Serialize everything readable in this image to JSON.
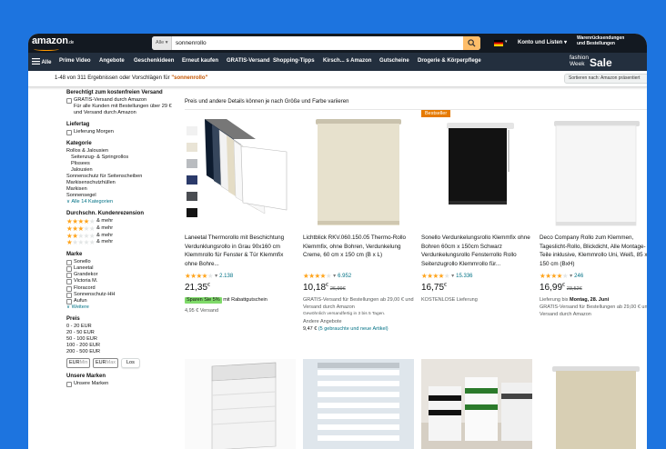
{
  "header": {
    "logo": "amazon",
    "logo_tld": ".de",
    "search_category": "Alle",
    "search_value": "sonnenrollo",
    "account": "Konto und Listen",
    "orders_line1": "Warenrücksendungen",
    "orders_line2": "und Bestellungen"
  },
  "nav": {
    "all": "Alle",
    "items": [
      "Prime Video",
      "Angebote",
      "Geschenkideen",
      "Erneut kaufen",
      "GRATIS-Versand",
      "Shopping-Tipps",
      "Kirsch... s Amazon",
      "Gutscheine",
      "Drogerie & Körperpflege"
    ],
    "fashion": "fashion",
    "fashion2": "Week",
    "sale": "Sale"
  },
  "results": {
    "count": "1-48 von 311 Ergebnissen oder Vorschlägen für ",
    "query": "\"sonnenrollo\"",
    "sort_label": "Sortieren nach:",
    "sort_value": "Amazon präsentiert"
  },
  "sidebar": {
    "free_shipping_heading": "Berechtigt zum kostenfreien Versand",
    "free_shipping_option": "GRATIS-Versand durch Amazon",
    "free_shipping_desc": "Für alle Kunden mit Bestellungen über 29 € und Versand durch Amazon",
    "delivery_heading": "Liefertag",
    "delivery_option": "Lieferung Morgen",
    "category_heading": "Kategorie",
    "categories": [
      "Rollos & Jalousien",
      "Seitenzug- & Springrollos",
      "Plissees",
      "Jalousien",
      "Sonnenschutz für Seitenscheiben",
      "Markisenschutzhüllen",
      "Markisen",
      "Sonnensegel"
    ],
    "categories_more": "∨ Alle 14 Kategorien",
    "review_heading": "Durchschn. Kundenrezension",
    "and_more": "& mehr",
    "brand_heading": "Marke",
    "brands": [
      "Sonello",
      "Laneetal",
      "Grandekor",
      "Victoria M.",
      "Floracord",
      "Sonnenschutz-HH",
      "Aufun"
    ],
    "brands_more": "∨ Weitere",
    "price_heading": "Preis",
    "prices": [
      "0 - 20 EUR",
      "20 - 50 EUR",
      "50 - 100 EUR",
      "100 - 200 EUR",
      "200 - 500 EUR"
    ],
    "min_prefix": "EUR",
    "min_placeholder": "Min",
    "max_prefix": "EUR",
    "max_placeholder": "Max",
    "go": "Los",
    "brands2_heading": "Unsere Marken",
    "brands2_option": "Unsere Marken"
  },
  "main": {
    "note": "Preis und andere Details können je nach Größe und Farbe variieren"
  },
  "products": [
    {
      "title": "Laneetal Thermorollo mit Beschichtung Verdunklungsrollo in Grau 90x160 cm Klemmrollo für Fenster & Tür Klemmfix ohne Bohre...",
      "rating": 4.2,
      "reviews": "2.138",
      "price_main": "21,35",
      "price_sup": "€",
      "old_price": "",
      "coupon": "Sparen Sie 5%",
      "coupon_text": " mit Rabattgutschein",
      "info": [
        "4,95 € Versand"
      ]
    },
    {
      "title": "Lichtblick RKV.060.150.05 Thermo-Rollo Klemmfix, ohne Bohren, Verdunkelung Creme, 60 cm x 150 cm (B x L)",
      "rating": 4.3,
      "reviews": "6.952",
      "price_main": "10,18",
      "price_sup": "€",
      "old_price": "26,99€",
      "info": [
        "GRATIS-Versand für Bestellungen ab 29,00 € und Versand durch Amazon",
        "Gewöhnlich versandfertig in 3 bis 5 Tagen.",
        "Andere Angebote"
      ],
      "offer": "9,47 € ",
      "offer_link": "(5 gebrauchte und neue Artikel)"
    },
    {
      "title": "Sonello Verdunkelungsrollo Klemmfix ohne Bohren 60cm x 150cm Schwarz Verdunkelungsrollo Fensterrollo Rollo Seitenzugrollo Klemmrollo für...",
      "badge": "Bestseller",
      "rating": 4.4,
      "reviews": "15.336",
      "price_main": "16,75",
      "price_sup": "€",
      "old_price": "",
      "info": [
        "KOSTENLOSE Lieferung"
      ]
    },
    {
      "title": "Deco Company Rollo zum Klemmen, Tageslicht-Rollo, Blickdicht, Alle Montage-Teile inklusive, Klemmrollo Uni, Weiß, 85 x 150 cm (BxH)",
      "rating": 4.3,
      "reviews": "246",
      "price_main": "16,99",
      "price_sup": "€",
      "old_price": "23,52€",
      "info_bold_prefix": "Lieferung bis ",
      "info_bold": "Montag, 28. Juni",
      "info": [
        "GRATIS-Versand für Bestellungen ab 29,00 € und Versand durch Amazon"
      ]
    }
  ]
}
